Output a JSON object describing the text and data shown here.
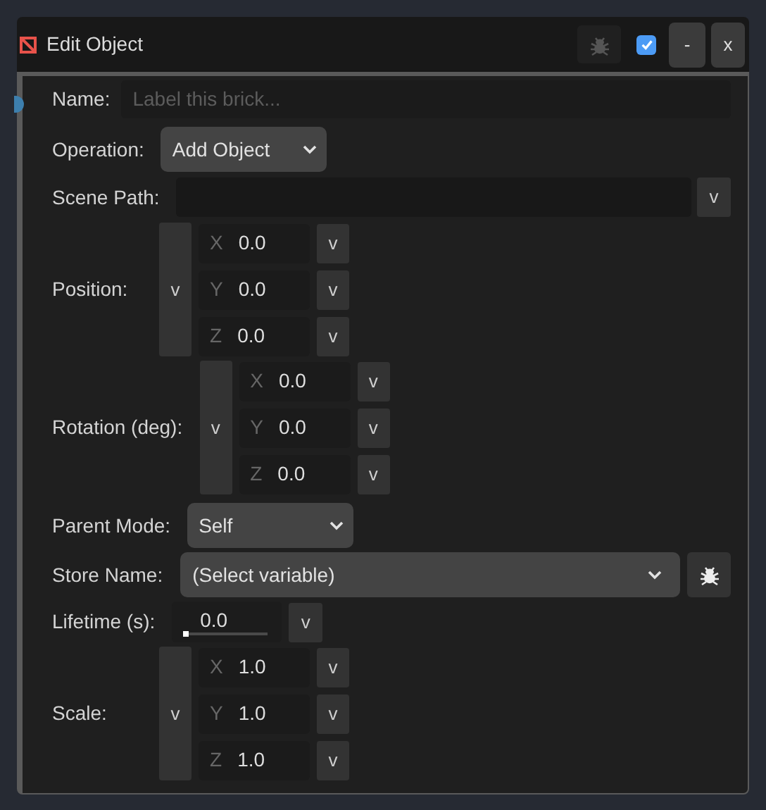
{
  "window": {
    "title": "Edit Object",
    "enabled": true,
    "buttons": [
      "-",
      "x"
    ]
  },
  "fields": [
    {
      "kind": "text",
      "label": "Name:",
      "placeholder": "Label this brick..."
    },
    {
      "kind": "dropdown",
      "label": "Operation:",
      "value": "Add Object"
    },
    {
      "kind": "path",
      "label": "Scene Path:",
      "button": "v"
    },
    {
      "kind": "vector",
      "label": "Position:",
      "button": "v",
      "components": [
        {
          "axis": "X",
          "value": "0.0",
          "button": "v"
        },
        {
          "axis": "Y",
          "value": "0.0",
          "button": "v"
        },
        {
          "axis": "Z",
          "value": "0.0",
          "button": "v"
        }
      ]
    },
    {
      "kind": "vector",
      "label": "Rotation (deg):",
      "button": "v",
      "components": [
        {
          "axis": "X",
          "value": "0.0",
          "button": "v"
        },
        {
          "axis": "Y",
          "value": "0.0",
          "button": "v"
        },
        {
          "axis": "Z",
          "value": "0.0",
          "button": "v"
        }
      ]
    },
    {
      "kind": "dropdown",
      "label": "Parent Mode:",
      "value": "Self"
    },
    {
      "kind": "variable",
      "label": "Store Name:",
      "value": "(Select variable)"
    },
    {
      "kind": "slider",
      "label": "Lifetime (s):",
      "value": "0.0",
      "level": 0,
      "button": "v"
    },
    {
      "kind": "vector",
      "label": "Scale:",
      "button": "v",
      "components": [
        {
          "axis": "X",
          "value": "1.0",
          "button": "v"
        },
        {
          "axis": "Y",
          "value": "1.0",
          "button": "v"
        },
        {
          "axis": "Z",
          "value": "1.0",
          "button": "v"
        }
      ]
    }
  ]
}
